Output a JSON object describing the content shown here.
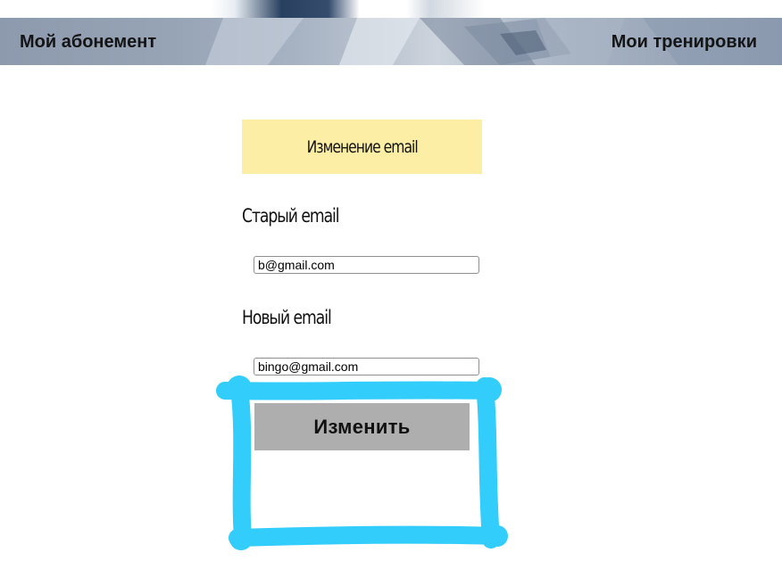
{
  "nav": {
    "left_label": "Мой абонемент",
    "right_label": "Мои тренировки"
  },
  "form": {
    "title": "Изменение email",
    "old_email_label": "Старый email",
    "old_email_value": "b@gmail.com",
    "new_email_label": "Новый email",
    "new_email_value": "bingo@gmail.com",
    "submit_label": "Изменить"
  },
  "colors": {
    "title_background": "#fdeea6",
    "button_background": "#aeaeae",
    "highlight_stroke": "#33cdfb"
  }
}
